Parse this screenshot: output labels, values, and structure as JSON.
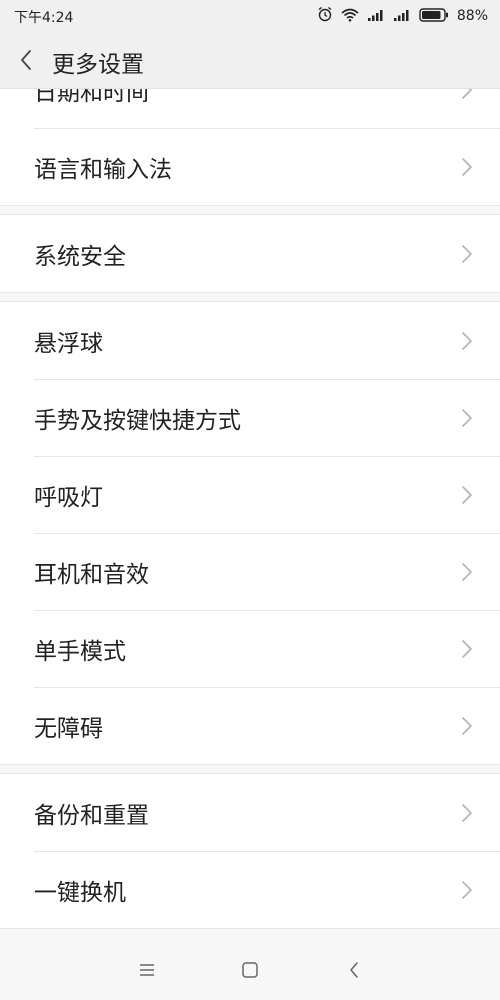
{
  "status_bar": {
    "time": "下午4:24",
    "battery_percent": "88%",
    "battery_level": 0.88,
    "icons": [
      "alarm-icon",
      "wifi-icon",
      "signal-icon",
      "signal-icon",
      "battery-icon"
    ]
  },
  "header": {
    "title": "更多设置",
    "back_icon": "back-chevron-icon"
  },
  "groups": [
    {
      "items": [
        {
          "label": "日期和时间"
        },
        {
          "label": "语言和输入法"
        }
      ]
    },
    {
      "items": [
        {
          "label": "系统安全"
        }
      ]
    },
    {
      "items": [
        {
          "label": "悬浮球"
        },
        {
          "label": "手势及按键快捷方式"
        },
        {
          "label": "呼吸灯"
        },
        {
          "label": "耳机和音效"
        },
        {
          "label": "单手模式"
        },
        {
          "label": "无障碍"
        }
      ]
    },
    {
      "items": [
        {
          "label": "备份和重置"
        },
        {
          "label": "一键换机"
        }
      ]
    }
  ],
  "nav_bar": {
    "icons": [
      "menu-icon",
      "home-icon",
      "back-icon"
    ]
  },
  "colors": {
    "background": "#f7f7f7",
    "header_bg": "#f0f0f0",
    "row_bg": "#ffffff",
    "divider": "#e6e6e6",
    "text": "#222222",
    "chevron": "#b3b3b3"
  }
}
